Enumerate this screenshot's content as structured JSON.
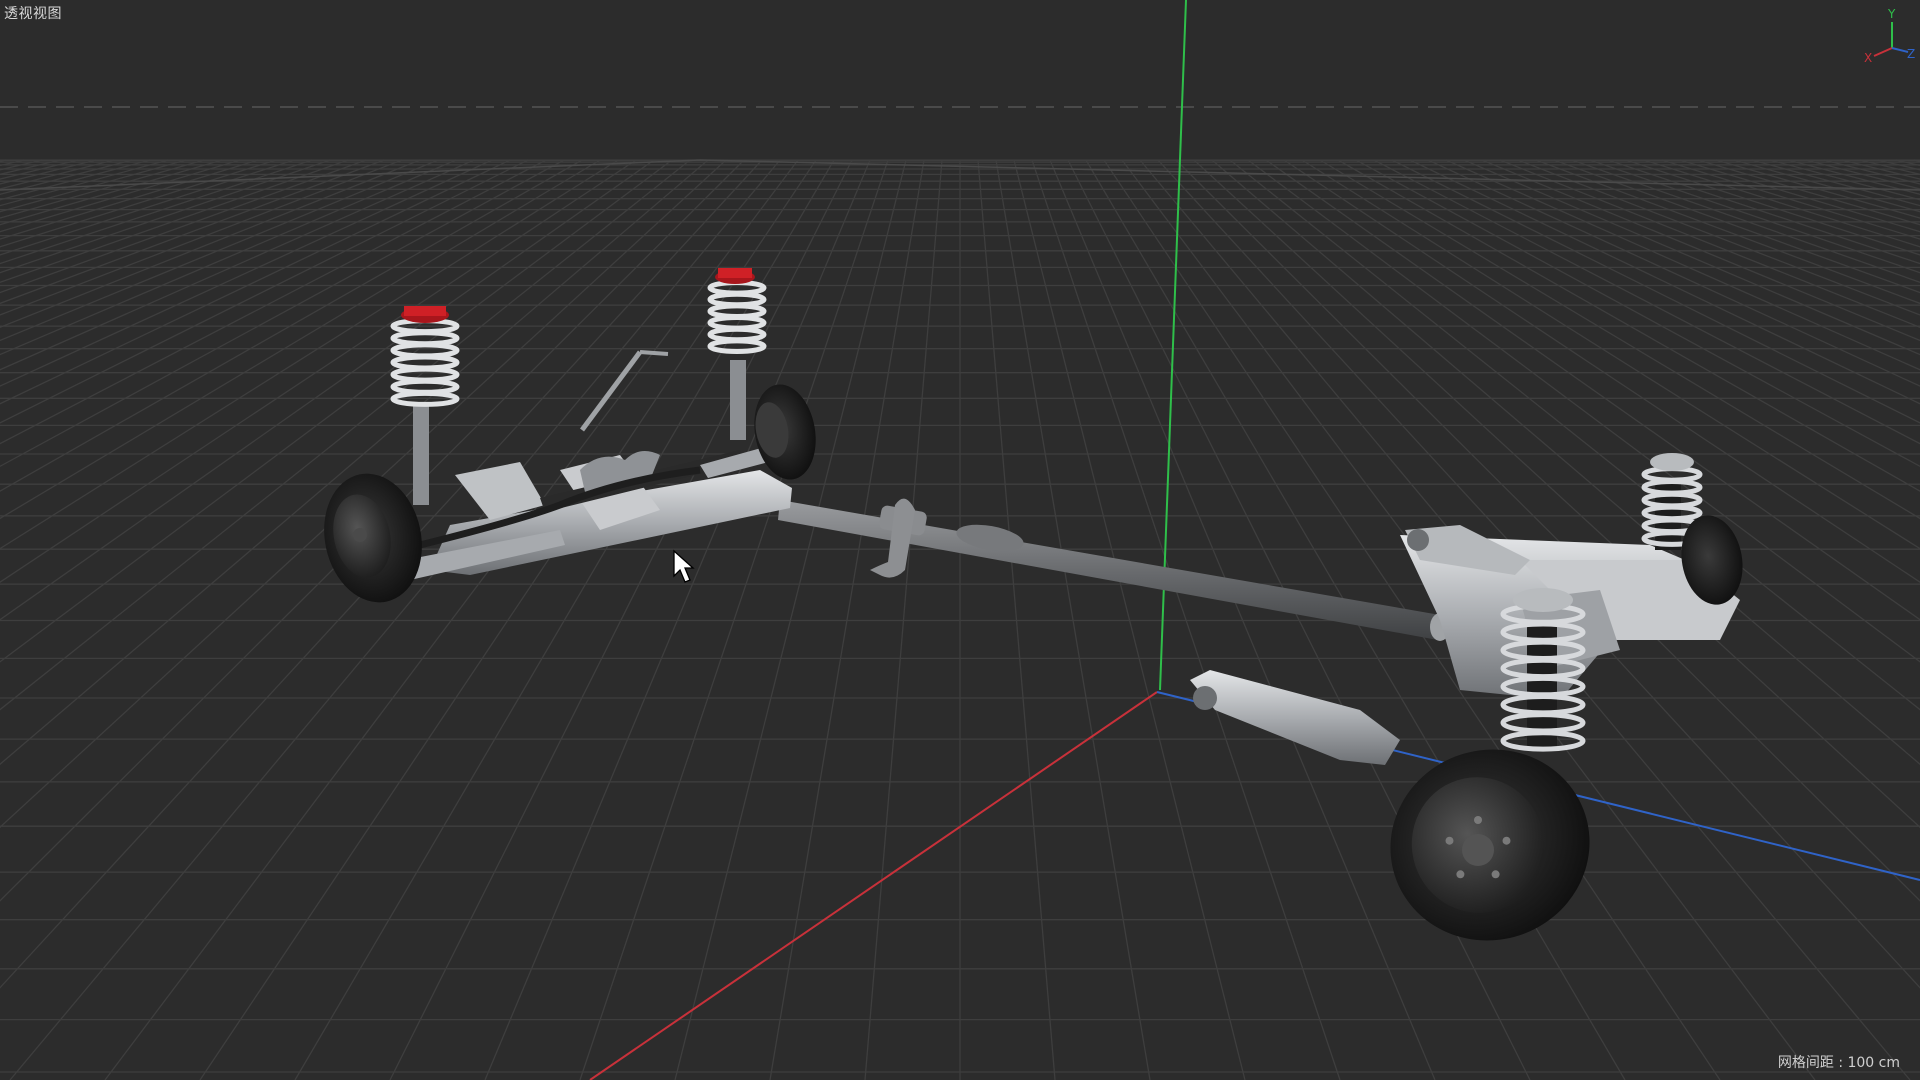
{
  "viewport": {
    "view_name": "透视视图",
    "grid_spacing_label": "网格间距 : 100 cm"
  },
  "axis_gizmo": {
    "x_label": "X",
    "y_label": "Y",
    "z_label": "Z"
  },
  "colors": {
    "background": "#2c2c2c",
    "grid_line": "#3d3d3d",
    "axis_x": "#c8313a",
    "axis_y": "#2fbf4a",
    "axis_z": "#2f63c8",
    "metal": "#b9bcc0",
    "tire": "#1a1a1a",
    "strut_cap": "#a8161c"
  },
  "scene_objects": {
    "model_name_icon": "car-suspension-chassis-icon"
  }
}
